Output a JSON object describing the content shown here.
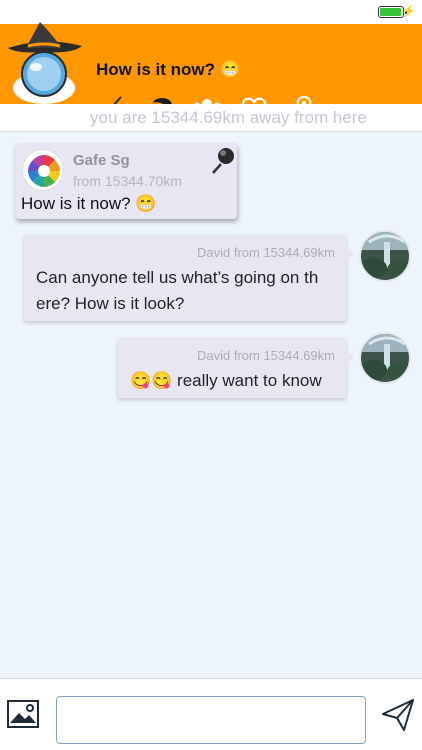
{
  "status_bar": {
    "battery_level": 1.0,
    "battery_color": "#35c43a",
    "charging_icon": "bolt-icon"
  },
  "header": {
    "background": "#ff9800",
    "title": "How is it now? 😁",
    "nav": [
      "back-icon",
      "chat-icon",
      "group-icon",
      "heart-add-icon",
      "map-pin-icon"
    ]
  },
  "distance_text": "you are 15344.69km away from here",
  "topic_card": {
    "name": "Gafe Sg",
    "from": "from 15344.70km",
    "text": "How is it now? 😁"
  },
  "messages": [
    {
      "meta": "David from 15344.69km",
      "line1": "Can anyone tell us what’s going on th",
      "line2": "ere? How is it look?"
    },
    {
      "meta": "David from 15344.69km",
      "text": "😋😋 really want to know"
    }
  ],
  "composer": {
    "input_value": "",
    "placeholder": ""
  }
}
